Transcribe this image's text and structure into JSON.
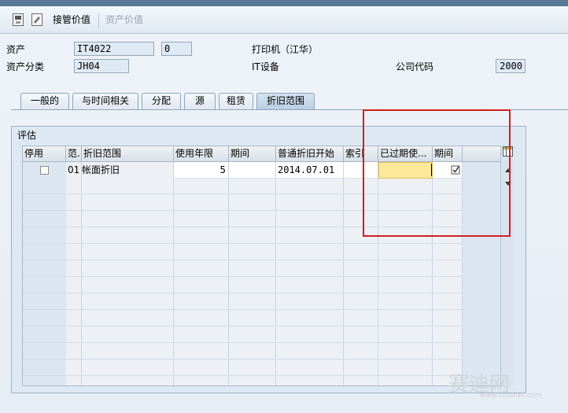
{
  "toolbar": {
    "takeover_label": "接管价值",
    "asset_value_label": "资产价值"
  },
  "header": {
    "asset_label": "资产",
    "asset_value": "IT4022",
    "subnumber_value": "0",
    "asset_desc": "打印机（江华）",
    "asset_class_label": "资产分类",
    "asset_class_value": "JH04",
    "asset_class_desc": "IT设备",
    "company_code_label": "公司代码",
    "company_code_value": "2000"
  },
  "tabs": [
    {
      "label": "一般的"
    },
    {
      "label": "与时间相关"
    },
    {
      "label": "分配"
    },
    {
      "label": "源"
    },
    {
      "label": "租赁"
    },
    {
      "label": "折旧范围"
    }
  ],
  "group": {
    "title": "评估"
  },
  "table": {
    "columns": [
      "停用",
      "范.",
      "折旧范围",
      "使用年限",
      "期间",
      "普通折旧开始",
      "索引",
      "已过期使...",
      "期间"
    ],
    "rows": [
      {
        "area": "01",
        "area_desc": "帐面折旧",
        "life": "5",
        "start": "2014.07.01"
      }
    ]
  },
  "watermark": {
    "text": "赛迪网",
    "sub": "www.ccidnet.com"
  }
}
